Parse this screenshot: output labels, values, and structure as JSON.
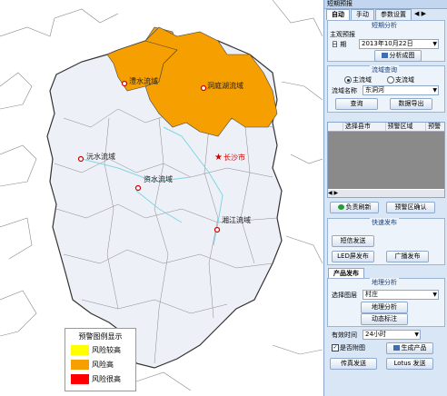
{
  "map": {
    "basins": [
      {
        "name": "澧水流域",
        "color": "#f5a000"
      },
      {
        "name": "洞庭湖流域",
        "color": "#f5a000"
      },
      {
        "name": "沅水流域",
        "color": "#eef0f8"
      },
      {
        "name": "资水流域",
        "color": "#eef0f8"
      },
      {
        "name": "湘江流域",
        "color": "#eef0f8"
      }
    ],
    "city": "长沙市",
    "legend": {
      "title": "预警图例显示",
      "items": [
        {
          "label": "风险较高",
          "color": "#ffff00"
        },
        {
          "label": "风险高",
          "color": "#f5a000"
        },
        {
          "label": "风险很高",
          "color": "#ff0000"
        }
      ]
    }
  },
  "panel": {
    "title": "短期预报",
    "tabs": [
      "自动",
      "手动",
      "参数设置"
    ],
    "tab_nav": "◀ ▶",
    "short_analysis": {
      "section": "短期分析",
      "group": "主观预报",
      "date_label": "日 期",
      "date_value": "2013年10月22日",
      "analyze_btn": "分析成图"
    },
    "basin_query": {
      "section": "流域查询",
      "radio_main": "主流域",
      "radio_sub": "支流域",
      "name_label": "流域名称",
      "name_value": "东洞河",
      "query_btn": "查询",
      "export_btn": "数据导出"
    },
    "table": {
      "headers": [
        "选择县市",
        "预警区域",
        "预警"
      ],
      "scroll": "◀ ▶"
    },
    "warn_actions": {
      "refresh_btn": "负责刷新",
      "confirm_btn": "预警区确认"
    },
    "quick_release": {
      "section": "快速发布",
      "sms_btn": "短信发送",
      "led_btn": "LED屏发布",
      "radio_btn": "广播发布"
    },
    "product": {
      "tab": "产品发布",
      "section": "地理分析",
      "layer_label": "选择图层",
      "layer_value": "村庄",
      "geo_btn": "地理分析",
      "dynamic_btn": "动态标注",
      "valid_label": "有效时间",
      "valid_value": "24小时",
      "checkbox_label": "是否附图",
      "gen_btn": "生成产品",
      "fax_btn": "传真发送",
      "lotus_btn": "Lotus 发送"
    }
  }
}
